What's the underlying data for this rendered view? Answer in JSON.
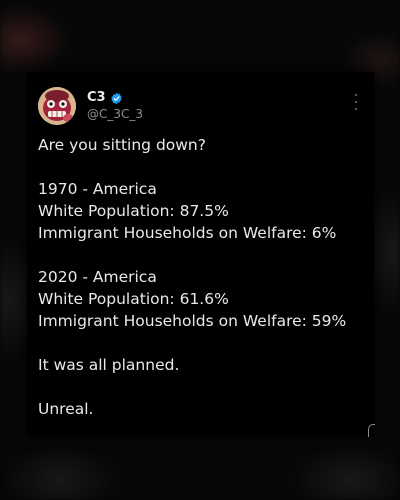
{
  "post": {
    "author": {
      "display_name": "C3",
      "handle": "@C_3C_3",
      "verified": true,
      "avatar_icon": "cartoon-avatar-icon"
    },
    "more_icon": "more-options-icon",
    "lines": [
      "Are you sitting down?",
      "",
      "1970 - America",
      "White Population: 87.5%",
      "Immigrant Households on Welfare: 6%",
      "",
      "2020 - America",
      "White Population: 61.6%",
      "Immigrant Households on Welfare: 59%",
      "",
      "It was all planned.",
      "",
      "Unreal."
    ]
  },
  "colors": {
    "background": "#060606",
    "card": "#000000",
    "text": "#e7e9ea",
    "secondary_text": "#8b8f93",
    "verified_badge": "#1d9bf0"
  }
}
